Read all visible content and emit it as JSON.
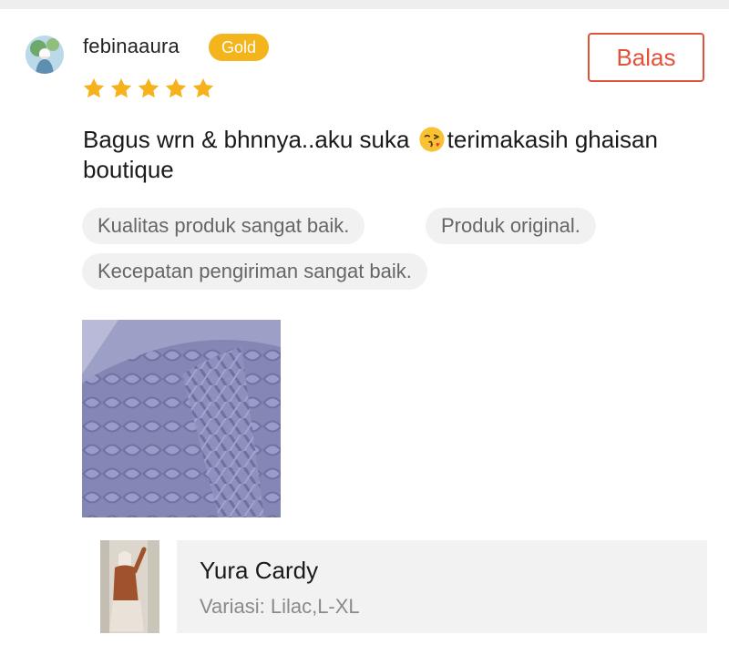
{
  "review": {
    "username": "febinaaura",
    "badge": "Gold",
    "rating": 5,
    "reply_label": "Balas",
    "text_part1": "Bagus wrn & bhnnya..aku suka ",
    "emoji": "kissing-face-emoji",
    "text_part2": "terimakasih ghaisan boutique",
    "tags": [
      "Kualitas produk sangat baik.",
      "Produk original.",
      "Kecepatan pengiriman sangat baik."
    ]
  },
  "product": {
    "name": "Yura Cardy",
    "variant": "Variasi: Lilac,L-XL"
  },
  "colors": {
    "accent": "#e0533a",
    "badge": "#f3b41c",
    "star": "#f6b21b",
    "chip_bg": "#f1f1f1",
    "card_bg": "#f2f2f2"
  }
}
